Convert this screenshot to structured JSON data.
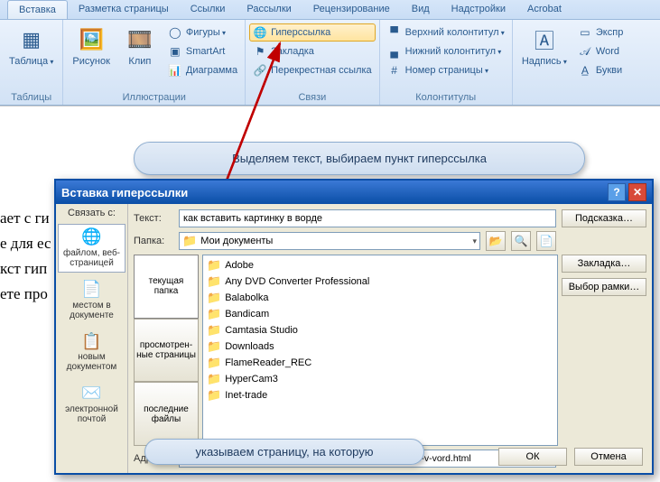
{
  "tabs": [
    "Вставка",
    "Разметка страницы",
    "Ссылки",
    "Рассылки",
    "Рецензирование",
    "Вид",
    "Надстройки",
    "Acrobat"
  ],
  "active_tab": 0,
  "ribbon": {
    "tables": {
      "label": "Таблицы",
      "btn": "Таблица"
    },
    "illustrations": {
      "label": "Иллюстрации",
      "pic": "Рисунок",
      "clip": "Клип",
      "shapes": "Фигуры",
      "smartart": "SmartArt",
      "chart": "Диаграмма"
    },
    "links": {
      "label": "Связи",
      "hyperlink": "Гиперссылка",
      "bookmark": "Закладка",
      "crossref": "Перекрестная ссылка"
    },
    "headerfooter": {
      "label": "Колонтитулы",
      "header": "Верхний колонтитул",
      "footer": "Нижний колонтитул",
      "pagenum": "Номер страницы"
    },
    "text": {
      "label": "",
      "textbox": "Надпись",
      "express": "Экспр",
      "wordart": "Word",
      "dropcap": "Букви"
    }
  },
  "callout1": "Выделяем текст, выбираем пункт гиперссылка",
  "callout2": "указываем страницу, на которую",
  "cut_lines": [
    "ает с ги",
    "е для ес",
    "кст гип",
    "ете про"
  ],
  "dialog": {
    "title": "Вставка гиперссылки",
    "link_to_label": "Связать с:",
    "types": [
      {
        "label": "файлом, веб-страницей",
        "icon": "🌐",
        "sel": true
      },
      {
        "label": "местом в документе",
        "icon": "📄",
        "sel": false
      },
      {
        "label": "новым документом",
        "icon": "📋",
        "sel": false
      },
      {
        "label": "электронной почтой",
        "icon": "✉️",
        "sel": false
      }
    ],
    "text_label": "Текст:",
    "text_value": "как вставить картинку в ворде",
    "hint_btn": "Подсказка…",
    "folder_label": "Папка:",
    "folder_value": "Мои документы",
    "view_tabs": [
      "текущая папка",
      "просмотрен-ные страницы",
      "последние файлы"
    ],
    "files": [
      "Adobe",
      "Any DVD Converter Professional",
      "Balabolka",
      "Bandicam",
      "Camtasia Studio",
      "Downloads",
      "FlameReader_REC",
      "HyperCam3",
      "Inet-trade"
    ],
    "bookmark_btn": "Закладка…",
    "frame_btn": "Выбор рамки…",
    "addr_label": "Адрес:",
    "addr_value": "http://kak-vybrat-klaviaturu-myshki.ru/kak-vstavit-kartinku-v-vord.html",
    "ok": "ОК",
    "cancel": "Отмена"
  }
}
